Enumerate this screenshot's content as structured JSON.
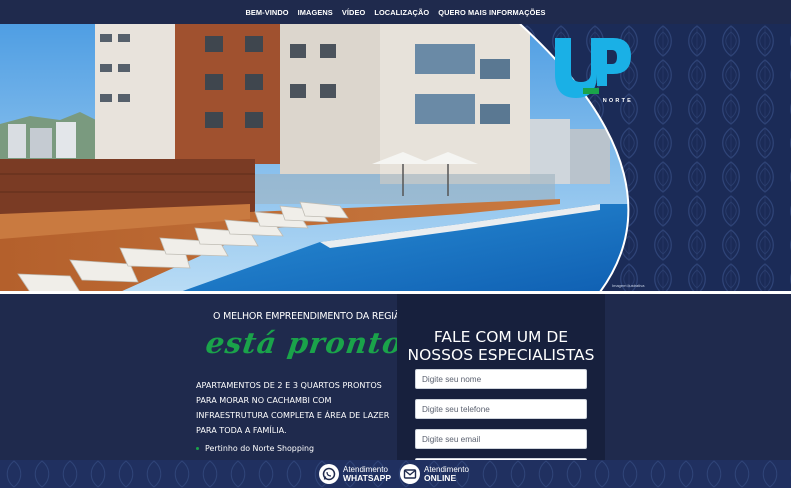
{
  "nav": {
    "items": [
      {
        "label": "BEM-VINDO"
      },
      {
        "label": "IMAGENS"
      },
      {
        "label": "VÍDEO"
      },
      {
        "label": "LOCALIZAÇÃO"
      },
      {
        "label": "QUERO MAIS INFORMAÇÕES"
      }
    ]
  },
  "logo": {
    "letters": "UP",
    "sub": "NORTE",
    "color": "#1ab0e6",
    "accent": "#1aa34a"
  },
  "hero": {
    "caption": "Imagem ilustrativa"
  },
  "intro": {
    "headline": "O MELHOR EMPREENDIMENTO DA REGIÃO",
    "script": "está pronto!",
    "description": "APARTAMENTOS DE 2 E 3 QUARTOS PRONTOS PARA MORAR NO CACHAMBI COM INFRAESTRUTURA COMPLETA E ÁREA DE LAZER PARA TODA A FAMÍLIA.",
    "bullets": [
      "Pertinho do Norte Shopping"
    ]
  },
  "form": {
    "title_line1": "FALE COM UM DE",
    "title_line2": "NOSSOS ESPECIALISTAS",
    "name_placeholder": "Digite seu nome",
    "phone_placeholder": "Digite seu telefone",
    "email_placeholder": "Digite seu email"
  },
  "footer": {
    "whatsapp_small": "Atendimento",
    "whatsapp_big": "WHATSAPP",
    "online_small": "Atendimento",
    "online_big": "ONLINE",
    "whatsapp_icon": "whatsapp-icon",
    "mail_icon": "mail-icon"
  },
  "colors": {
    "navy": "#1f2a4d",
    "green": "#1aa34a",
    "blue": "#1ab0e6"
  }
}
